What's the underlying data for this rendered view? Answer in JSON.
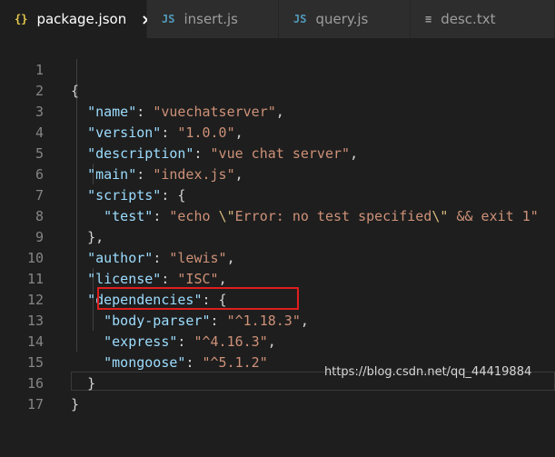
{
  "tabs": [
    {
      "icon": "{}",
      "label": "package.json",
      "close": "×",
      "active": true
    },
    {
      "icon": "JS",
      "label": "insert.js"
    },
    {
      "icon": "JS",
      "label": "query.js"
    },
    {
      "icon": "≡",
      "label": "desc.txt"
    }
  ],
  "lines": [
    {
      "num": "1"
    },
    {
      "num": "2"
    },
    {
      "num": "3"
    },
    {
      "num": "4"
    },
    {
      "num": "5"
    },
    {
      "num": "6"
    },
    {
      "num": "7"
    },
    {
      "num": "8"
    },
    {
      "num": "9"
    },
    {
      "num": "10"
    },
    {
      "num": "11"
    },
    {
      "num": "12"
    },
    {
      "num": "13"
    },
    {
      "num": "14"
    },
    {
      "num": "15"
    },
    {
      "num": "16"
    },
    {
      "num": "17"
    }
  ],
  "code": {
    "brace_open": "{",
    "name_key": "\"name\"",
    "name_val": "\"vuechatserver\"",
    "version_key": "\"version\"",
    "version_val": "\"1.0.0\"",
    "description_key": "\"description\"",
    "description_val": "\"vue chat server\"",
    "main_key": "\"main\"",
    "main_val": "\"index.js\"",
    "scripts_key": "\"scripts\"",
    "test_key": "\"test\"",
    "test_val_1": "\"echo ",
    "test_esc_1": "\\\"",
    "test_val_2": "Error: no test specified",
    "test_esc_2": "\\\"",
    "test_val_3": " && exit 1\"",
    "scripts_close": "},",
    "author_key": "\"author\"",
    "author_val": "\"lewis\"",
    "license_key": "\"license\"",
    "license_val": "\"ISC\"",
    "dependencies_key": "\"dependencies\"",
    "bodyparser_key": "\"body-parser\"",
    "bodyparser_val": "\"^1.18.3\"",
    "express_key": "\"express\"",
    "express_val": "\"^4.16.3\"",
    "mongoose_key": "\"mongoose\"",
    "mongoose_val": "\"^5.1.2\"",
    "dependencies_close": "}",
    "brace_close": "}"
  },
  "watermark": "https://blog.csdn.net/qq_44419884",
  "colors": {
    "key": "#9cdcfe",
    "string": "#ce9178",
    "escape": "#d7ba7d",
    "highlight_box": "#e01e1e"
  }
}
